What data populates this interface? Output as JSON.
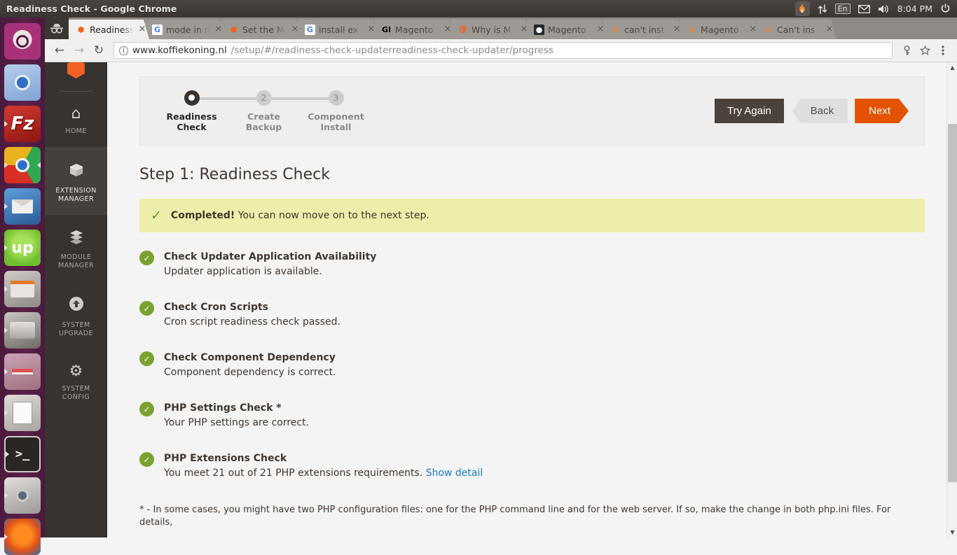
{
  "window": {
    "title": "Readiness Check - Google Chrome"
  },
  "tray": {
    "flame_icon": "flame-icon",
    "network_icon": "network-updown-icon",
    "language": "En",
    "mail_icon": "envelope-icon",
    "volume_icon": "speaker-icon",
    "clock": "8:04 PM",
    "power_icon": "power-gear-icon"
  },
  "launcher": {
    "items": [
      {
        "name": "ubuntu-dash",
        "icon": "ubuntu-logo-icon"
      },
      {
        "name": "web-browser",
        "icon": "browser-icon"
      },
      {
        "name": "filezilla",
        "icon": "filezilla-icon",
        "label": "Fz"
      },
      {
        "name": "google-chrome",
        "icon": "chrome-icon"
      },
      {
        "name": "thunderbird",
        "icon": "thunderbird-icon"
      },
      {
        "name": "upwork",
        "icon": "upwork-icon",
        "label": "up"
      },
      {
        "name": "files",
        "icon": "file-manager-icon"
      },
      {
        "name": "disks",
        "icon": "disk-icon"
      },
      {
        "name": "xampp",
        "icon": "xampp-icon"
      },
      {
        "name": "text-editor",
        "icon": "text-editor-icon"
      },
      {
        "name": "terminal",
        "icon": "terminal-icon",
        "label": ">_"
      },
      {
        "name": "camera",
        "icon": "camera-icon"
      },
      {
        "name": "firefox",
        "icon": "firefox-icon"
      }
    ]
  },
  "browser": {
    "incognito_icon": "incognito-icon",
    "tabs": [
      {
        "title": "Readiness",
        "favicon": "magento-icon",
        "active": true
      },
      {
        "title": "mode in m",
        "favicon": "google-icon",
        "active": false
      },
      {
        "title": "Set the M",
        "favicon": "magento-icon",
        "active": false
      },
      {
        "title": "install ex",
        "favicon": "google-icon",
        "active": false
      },
      {
        "title": "Magento",
        "favicon": "gi-icon",
        "active": false
      },
      {
        "title": "Why is M",
        "favicon": "shield-icon",
        "active": false
      },
      {
        "title": "Magento",
        "favicon": "github-icon",
        "active": false
      },
      {
        "title": "can't inst",
        "favicon": "stackoverflow-icon",
        "active": false
      },
      {
        "title": "Magento",
        "favicon": "stackoverflow-icon",
        "active": false
      },
      {
        "title": "Can't ins",
        "favicon": "stackoverflow-icon",
        "active": false
      }
    ],
    "close_glyph": "×",
    "toolbar": {
      "back_icon": "back-arrow-icon",
      "forward_icon": "forward-arrow-icon",
      "reload_icon": "reload-icon",
      "info_glyph": "i",
      "url_host": "www.koffiekoning.nl",
      "url_path": "/setup/#/readiness-check-updaterreadiness-check-updater/progress",
      "key_icon": "key-icon",
      "star_icon": "star-icon",
      "menu_icon": "three-dot-menu-icon"
    }
  },
  "magento_sidebar": {
    "logo_icon": "magento-logo-icon",
    "items": [
      {
        "label": "HOME",
        "icon": "home-icon",
        "active": false
      },
      {
        "label": "EXTENSION\nMANAGER",
        "label_line1": "EXTENSION",
        "label_line2": "MANAGER",
        "icon": "box-icon",
        "active": true
      },
      {
        "label_line1": "MODULE",
        "label_line2": "MANAGER",
        "icon": "blocks-icon",
        "active": false
      },
      {
        "label_line1": "SYSTEM",
        "label_line2": "UPGRADE",
        "icon": "upload-arrow-icon",
        "active": false
      },
      {
        "label_line1": "SYSTEM",
        "label_line2": "CONFIG",
        "icon": "gear-icon",
        "active": false
      }
    ]
  },
  "stepper": {
    "steps": [
      {
        "number": "1",
        "line1": "Readiness",
        "line2": "Check",
        "active": true
      },
      {
        "number": "2",
        "line1": "Create",
        "line2": "Backup",
        "active": false
      },
      {
        "number": "3",
        "line1": "Component",
        "line2": "Install",
        "active": false
      }
    ],
    "buttons": {
      "try_again": "Try Again",
      "back": "Back",
      "next": "Next"
    }
  },
  "page": {
    "heading": "Step 1: Readiness Check",
    "banner": {
      "check_icon": "checkmark-icon",
      "strong": "Completed!",
      "text": " You can now move on to the next step."
    },
    "checks": [
      {
        "title": "Check Updater Application Availability",
        "desc": "Updater application is available.",
        "status": "success"
      },
      {
        "title": "Check Cron Scripts",
        "desc": "Cron script readiness check passed.",
        "status": "success"
      },
      {
        "title": "Check Component Dependency",
        "desc": "Component dependency is correct.",
        "status": "success"
      },
      {
        "title": "PHP Settings Check *",
        "desc": "Your PHP settings are correct.",
        "status": "success"
      },
      {
        "title": "PHP Extensions Check",
        "desc": "You meet 21 out of 21 PHP extensions requirements.",
        "link": "Show detail",
        "status": "success"
      }
    ],
    "footnote": "* - In some cases, you might have two PHP configuration files: one for the PHP command line and for the web server. If so, make the change in both php.ini files. For details,"
  },
  "colors": {
    "accent_orange": "#e25200",
    "magento_orange": "#f26322",
    "success_green": "#79a22e",
    "banner_yellow": "#eeeeaa",
    "link_blue": "#1979c3",
    "sidebar_dark": "#373330",
    "launcher_purple": "#5b2049"
  }
}
